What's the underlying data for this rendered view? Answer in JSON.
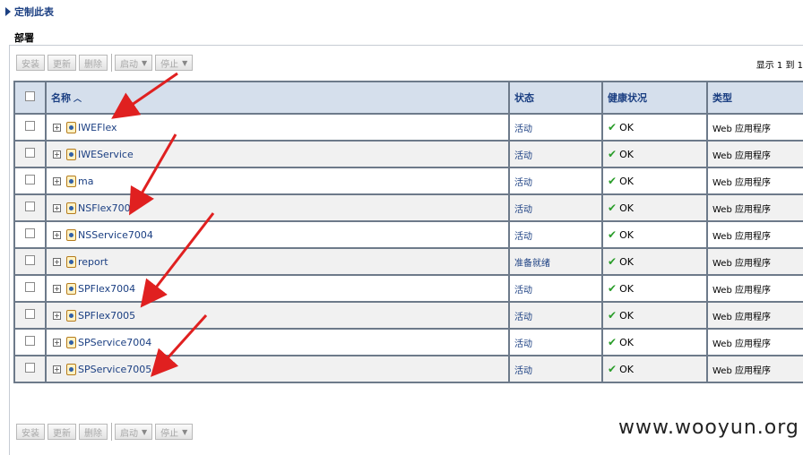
{
  "customize_label": "定制此表",
  "section_title": "部署",
  "toolbar": {
    "install": "安装",
    "update": "更新",
    "delete": "删除",
    "start": "启动",
    "stop": "停止"
  },
  "pager": "显示 1 到 1",
  "columns": {
    "name": "名称",
    "status": "状态",
    "health": "健康状况",
    "type": "类型"
  },
  "rows": [
    {
      "name": "IWEFlex",
      "status": "活动",
      "health": "OK",
      "type": "Web 应用程序"
    },
    {
      "name": "IWEService",
      "status": "活动",
      "health": "OK",
      "type": "Web 应用程序"
    },
    {
      "name": "ma",
      "status": "活动",
      "health": "OK",
      "type": "Web 应用程序"
    },
    {
      "name": "NSFlex7004",
      "status": "活动",
      "health": "OK",
      "type": "Web 应用程序"
    },
    {
      "name": "NSService7004",
      "status": "活动",
      "health": "OK",
      "type": "Web 应用程序"
    },
    {
      "name": "report",
      "status": "准备就绪",
      "health": "OK",
      "type": "Web 应用程序"
    },
    {
      "name": "SPFlex7004",
      "status": "活动",
      "health": "OK",
      "type": "Web 应用程序"
    },
    {
      "name": "SPFlex7005",
      "status": "活动",
      "health": "OK",
      "type": "Web 应用程序"
    },
    {
      "name": "SPService7004",
      "status": "活动",
      "health": "OK",
      "type": "Web 应用程序"
    },
    {
      "name": "SPService7005",
      "status": "活动",
      "health": "OK",
      "type": "Web 应用程序"
    }
  ],
  "watermark": "www.wooyun.org",
  "colors": {
    "link": "#1b3f82",
    "header_bg": "#d5dfec",
    "ok_green": "#2a9d2a",
    "annotation_red": "#e02020"
  }
}
